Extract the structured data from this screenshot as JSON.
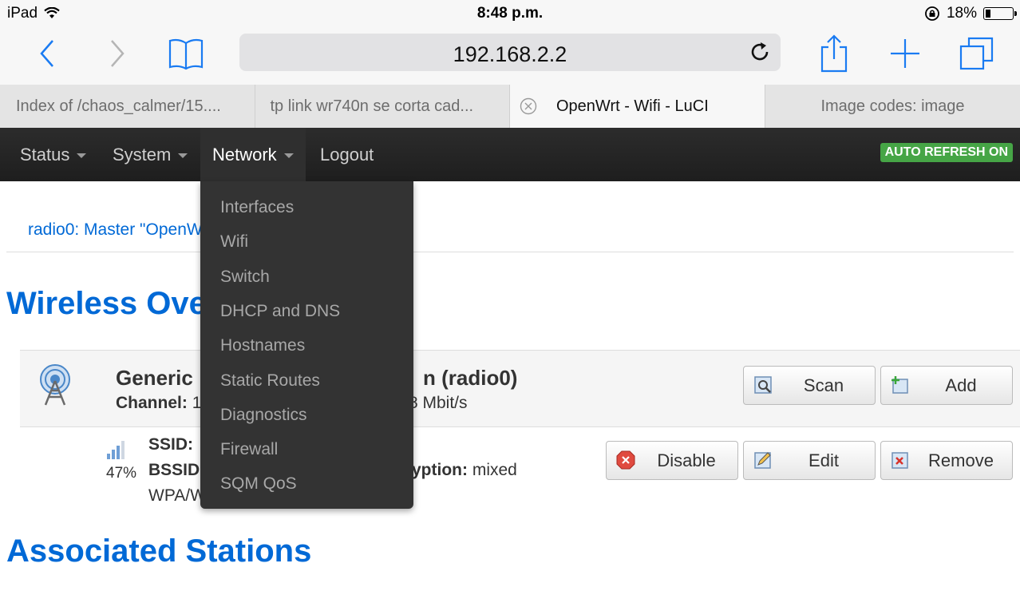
{
  "status_bar": {
    "device": "iPad",
    "time": "8:48 p.m.",
    "battery_pct_text": "18%",
    "battery_level": 0.18
  },
  "toolbar": {
    "url": "192.168.2.2"
  },
  "tabs": [
    {
      "label": "Index of /chaos_calmer/15...."
    },
    {
      "label": "tp link wr740n se corta cad..."
    },
    {
      "label": "OpenWrt - Wifi - LuCI",
      "active": true
    },
    {
      "label": "Image codes: image"
    }
  ],
  "nav": {
    "items": [
      "Status",
      "System",
      "Network",
      "Logout"
    ],
    "auto_refresh": "AUTO REFRESH ON"
  },
  "network_menu": [
    "Interfaces",
    "Wifi",
    "Switch",
    "DHCP and DNS",
    "Hostnames",
    "Static Routes",
    "Diagnostics",
    "Firewall",
    "SQM QoS"
  ],
  "content": {
    "breadcrumb": "radio0: Master \"OpenW",
    "wireless_heading": "Wireless Ove",
    "device": {
      "name": "Generic",
      "name_tail": "n (radio0)",
      "channel_label": "Channel:",
      "channel_value": "1",
      "bitrate_tail": "8 Mbit/s"
    },
    "buttons": {
      "scan": "Scan",
      "add": "Add",
      "disable": "Disable",
      "edit": "Edit",
      "remove": "Remove"
    },
    "network": {
      "signal_pct": "47%",
      "ssid_label": "SSID:",
      "bssid_label": "BSSID",
      "encryption_label_tail": "yption:",
      "encryption_value": "mixed",
      "encryption_line2": "WPA/W"
    },
    "associated_heading": "Associated Stations"
  }
}
